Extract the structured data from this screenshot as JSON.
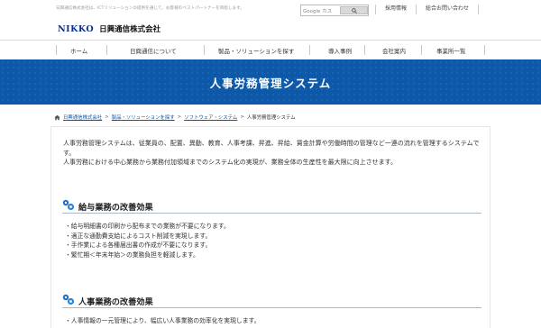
{
  "top": {
    "tagline": "日興通信株式会社は、ICTソリューションの提供を通じて、お客様のベストパートナーを目指します。",
    "search_brand": "Google カス",
    "util_links": [
      "採用情報",
      "総合お問い合わせ"
    ]
  },
  "logo": {
    "mark": "NIKKO",
    "name": "日興通信株式会社"
  },
  "nav": {
    "items": [
      "ホーム",
      "日興通信について",
      "製品・ソリューションを探す",
      "導入事例",
      "会社案内",
      "事業所一覧"
    ]
  },
  "page": {
    "title": "人事労務管理システム"
  },
  "breadcrumb": {
    "links": [
      "日興通信株式会社",
      "製品・ソリューションを探す",
      "ソフトウェア・システム"
    ],
    "current": "人事労務管理システム"
  },
  "intro": {
    "line1": "人事労務管理システムは、従業員の、配置、異動、教育、人事考課、昇進、昇給、賃金計算や労働時間の管理など一連の流れを管理するシステムです。",
    "line2": "人事労務における中心業務から業務付加領域までのシステム化の実現が、業務全体の生産性を最大限に向上させます。"
  },
  "sections": [
    {
      "title": "給与業務の改善効果",
      "bullets": [
        "・給与明細書の印刷から配布までの業務が不要になります。",
        "・適正な通勤費支給によるコスト削減を実現します。",
        "・手作業による各種届出書の作成が不要になります。",
        "・繁忙期＜年末年始＞の業務負担を軽減します。"
      ]
    },
    {
      "title": "人事業務の改善効果",
      "bullets": [
        "・人事情報の一元管理により、幅広い人事業務の効率化を実現します。"
      ]
    }
  ],
  "colors": {
    "brand_blue": "#0d58a8",
    "logo_navy": "#0a2f8e"
  }
}
